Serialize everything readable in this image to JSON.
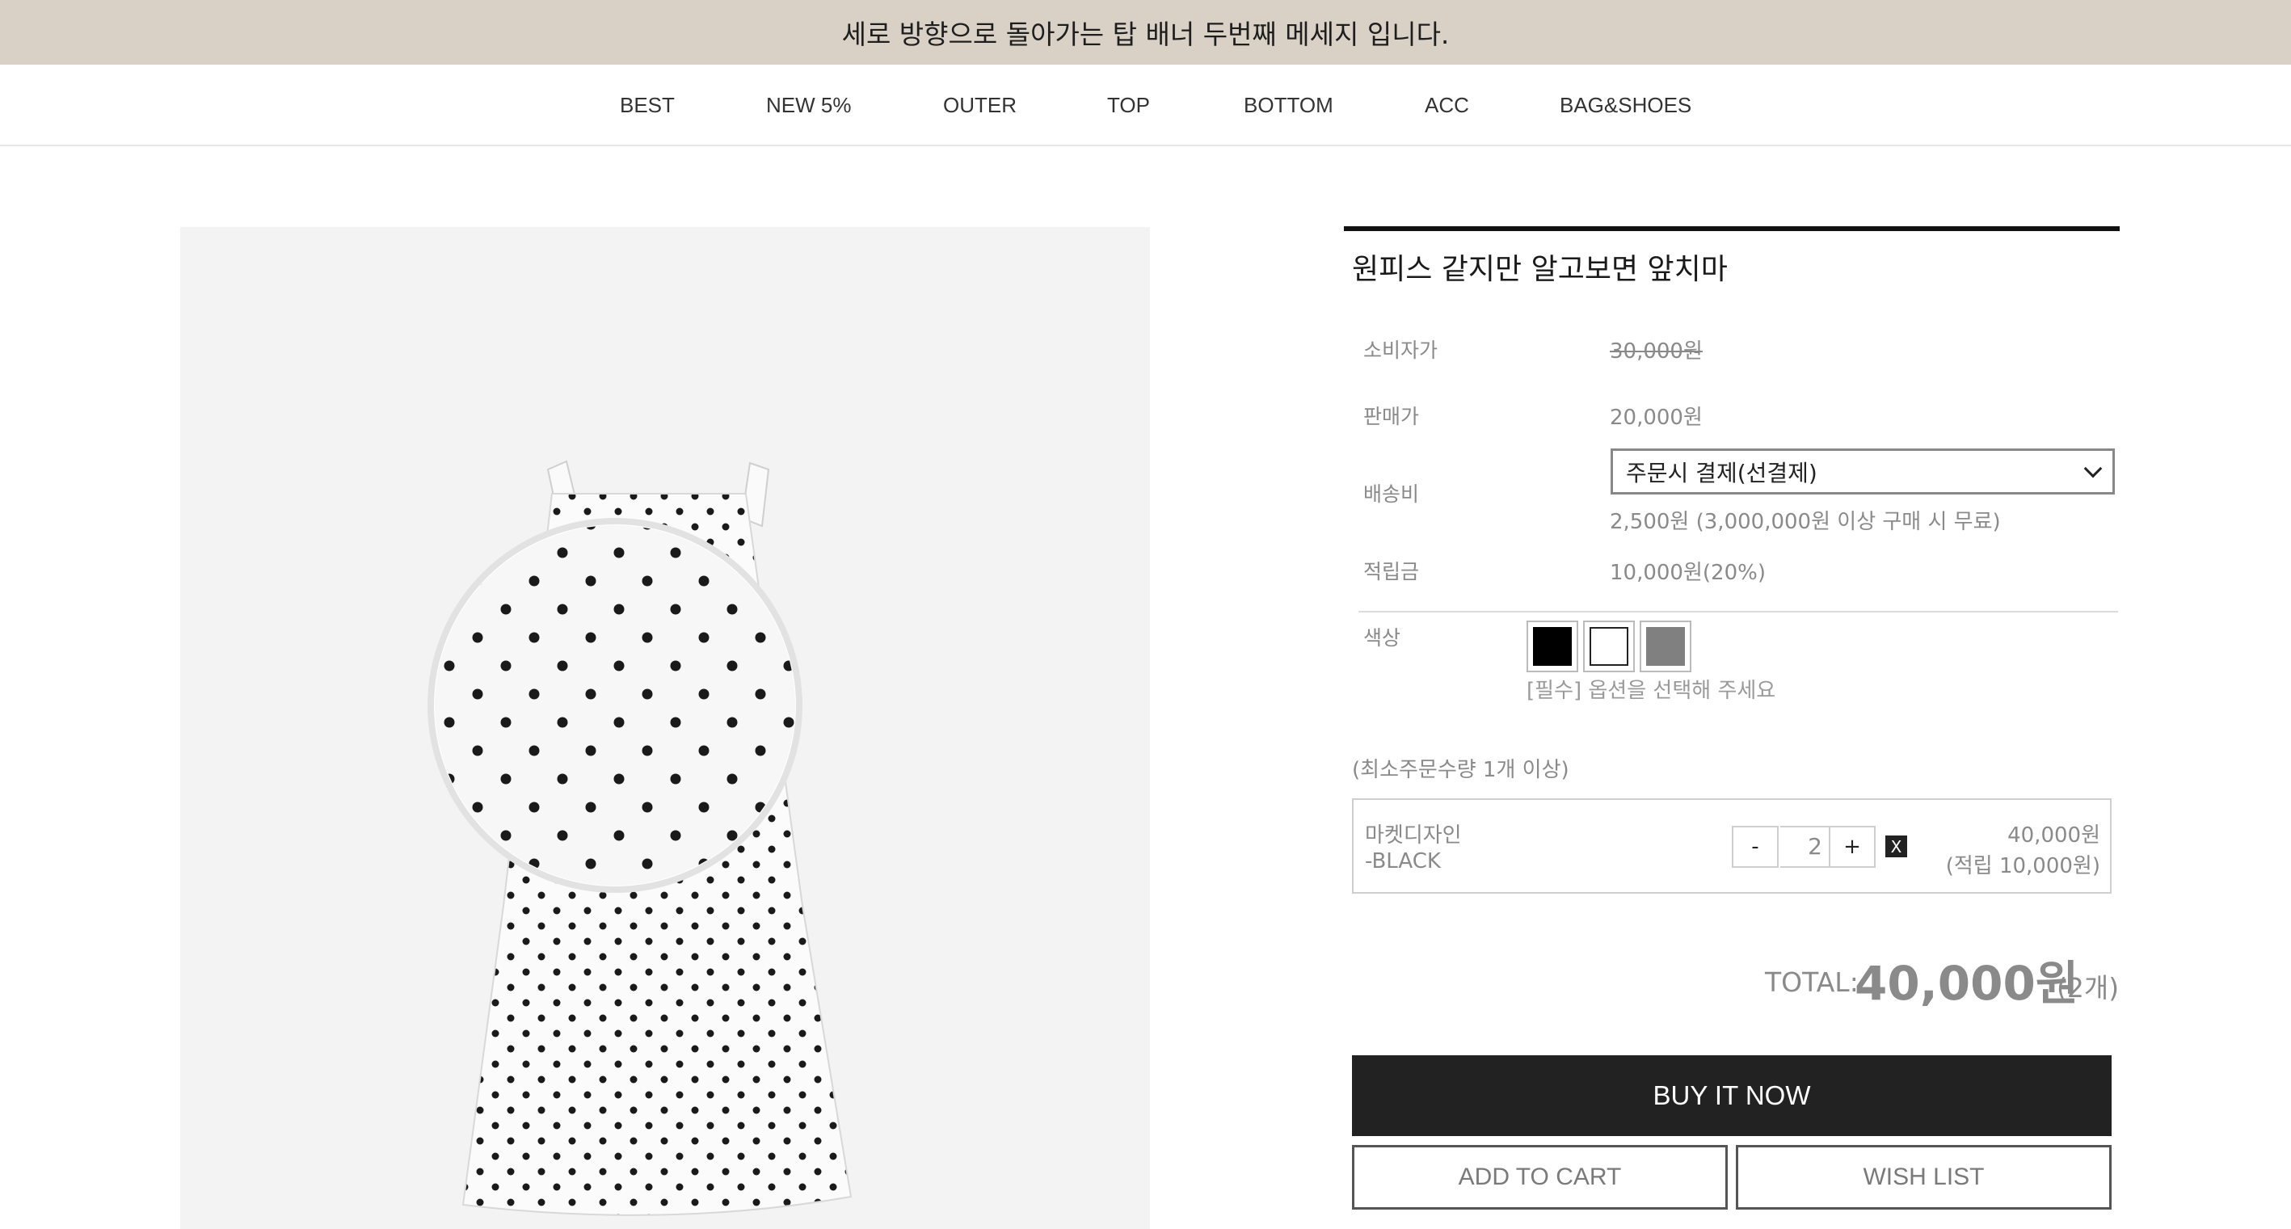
{
  "banner": {
    "message": "세로 방향으로 돌아가는 탑 배너 두번째 메세지 입니다."
  },
  "nav": {
    "items": [
      "BEST",
      "NEW 5%",
      "OUTER",
      "TOP",
      "BOTTOM",
      "ACC",
      "BAG&SHOES"
    ]
  },
  "product": {
    "title": "원피스 같지만 알고보면 앞치마",
    "retail_label": "소비자가",
    "retail_price": "30,000원",
    "sale_label": "판매가",
    "sale_price": "20,000원",
    "shipping_label": "배송비",
    "shipping_selected": "주문시 결제(선결제)",
    "shipping_note": "2,500원 (3,000,000원 이상 구매 시 무료)",
    "points_label": "적립금",
    "points_value": "10,000원(20%)",
    "color_label": "색상",
    "colors": [
      "#000000",
      "#ffffff",
      "#808080"
    ],
    "color_hint": "[필수] 옵션을 선택해 주세요",
    "min_qty_note": "(최소주문수량 1개 이상)"
  },
  "selected_option": {
    "name": "마켓디자인",
    "variant": "-BLACK",
    "minus_label": "-",
    "quantity": "2",
    "plus_label": "+",
    "remove_label": "X",
    "price": "40,000원",
    "points": "(적립 10,000원)"
  },
  "total": {
    "label": "TOTAL:",
    "amount": "40,000원",
    "count": "(2개)"
  },
  "buttons": {
    "buy_now": "BUY IT NOW",
    "add_to_cart": "ADD TO CART",
    "wish_list": "WISH LIST"
  }
}
